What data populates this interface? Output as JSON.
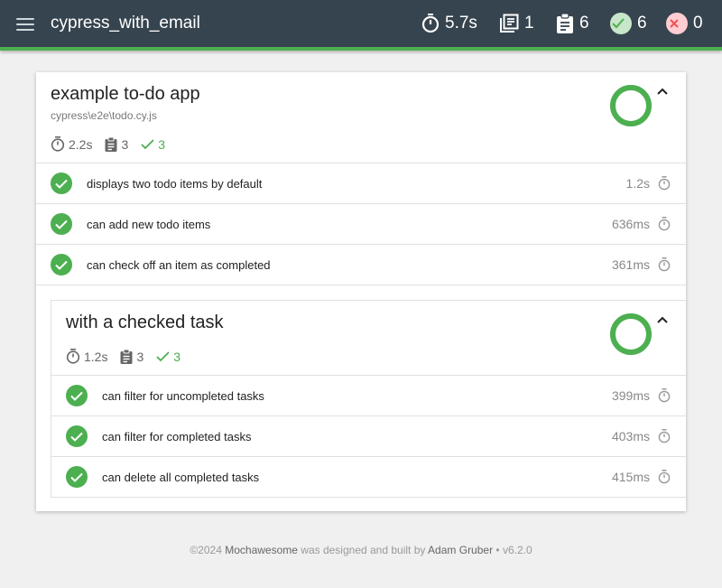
{
  "app": {
    "title": "cypress_with_email"
  },
  "stats": {
    "duration": "5.7s",
    "suites": "1",
    "tests": "6",
    "passes": "6",
    "failures": "0"
  },
  "colors": {
    "pass": "#4caf50",
    "topbar": "#36444f",
    "fail": "#ef5350"
  },
  "suite": {
    "title": "example to-do app",
    "file": "cypress\\e2e\\todo.cy.js",
    "duration": "2.2s",
    "tests": "3",
    "passes": "3",
    "pass_fraction": 1.0,
    "items": [
      {
        "title": "displays two todo items by default",
        "duration": "1.2s"
      },
      {
        "title": "can add new todo items",
        "duration": "636ms"
      },
      {
        "title": "can check off an item as completed",
        "duration": "361ms"
      }
    ]
  },
  "subsuite": {
    "title": "with a checked task",
    "duration": "1.2s",
    "tests": "3",
    "passes": "3",
    "pass_fraction": 1.0,
    "items": [
      {
        "title": "can filter for uncompleted tasks",
        "duration": "399ms"
      },
      {
        "title": "can filter for completed tasks",
        "duration": "403ms"
      },
      {
        "title": "can delete all completed tasks",
        "duration": "415ms"
      }
    ]
  },
  "footer": {
    "copyright": "©2024",
    "brand": "Mochawesome",
    "mid": "was designed and built by",
    "author": "Adam Gruber",
    "version": "• v6.2.0"
  }
}
